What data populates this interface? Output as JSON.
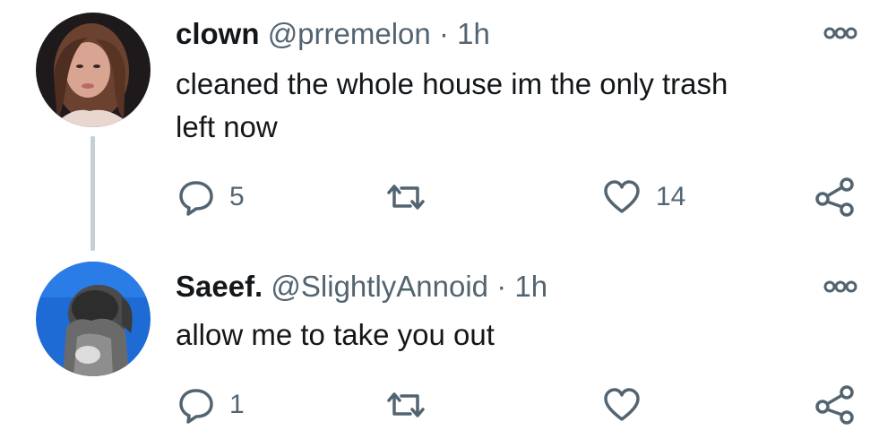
{
  "tweets": [
    {
      "name": "clown",
      "handle": "@prremelon",
      "separator": "·",
      "time": "1h",
      "text": "cleaned the whole house im the only trash\nleft now",
      "reply_count": "5",
      "like_count": "14",
      "avatar_icon": "user-avatar-photo"
    },
    {
      "name": "Saeef.",
      "handle": "@SlightlyAnnoid",
      "separator": "·",
      "time": "1h",
      "text": "allow me to take you out",
      "reply_count": "1",
      "like_count": "",
      "avatar_icon": "user-avatar-photo"
    }
  ],
  "icons": {
    "reply": "reply-bubble-icon",
    "retweet": "retweet-icon",
    "like": "heart-icon",
    "share": "share-icon",
    "more": "more-dots-icon"
  },
  "colors": {
    "text": "#14171a",
    "muted": "#536471",
    "thread_line": "#c4cfd6"
  }
}
